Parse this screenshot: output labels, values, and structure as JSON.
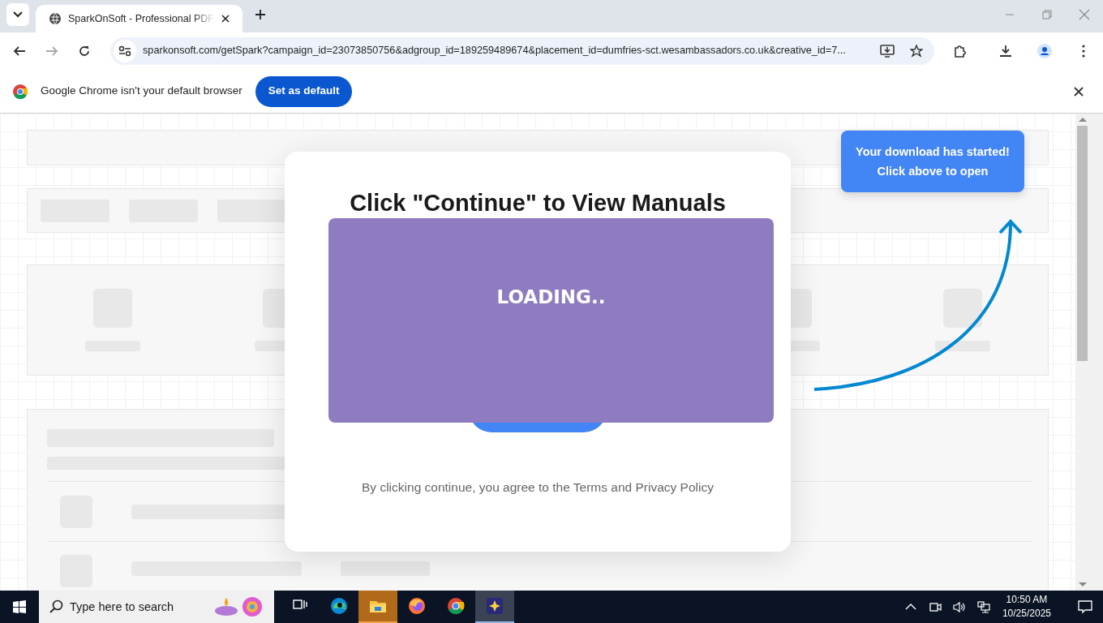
{
  "browser": {
    "tabs": [
      {
        "title": "SparkOnSoft - Professional PDF",
        "selected": true
      }
    ],
    "address": "sparkonsoft.com/getSpark?campaign_id=23073850756&adgroup_id=189259489674&placement_id=dumfries-sct.wesambassadors.co.uk&creative_id=7...",
    "infobar": {
      "message": "Google Chrome isn't your default browser",
      "button": "Set as default"
    }
  },
  "page": {
    "modal": {
      "heading": "Click \"Continue\" to View Manuals",
      "loading_text": "LOADING..",
      "footer": "By clicking continue, you agree to the Terms and Privacy Policy"
    },
    "toast": {
      "lines": [
        "Your download has started!",
        "Click above to open"
      ]
    }
  },
  "taskbar": {
    "search_placeholder": "Type here to search",
    "apps": [
      {
        "kind": "taskview",
        "active": false
      },
      {
        "kind": "edge",
        "active": false
      },
      {
        "kind": "explorer",
        "active": true
      },
      {
        "kind": "firefox",
        "active": false
      },
      {
        "kind": "chrome",
        "active": false
      },
      {
        "kind": "app",
        "active": true
      }
    ],
    "time": "10:50 AM",
    "date": "10/25/2025"
  }
}
